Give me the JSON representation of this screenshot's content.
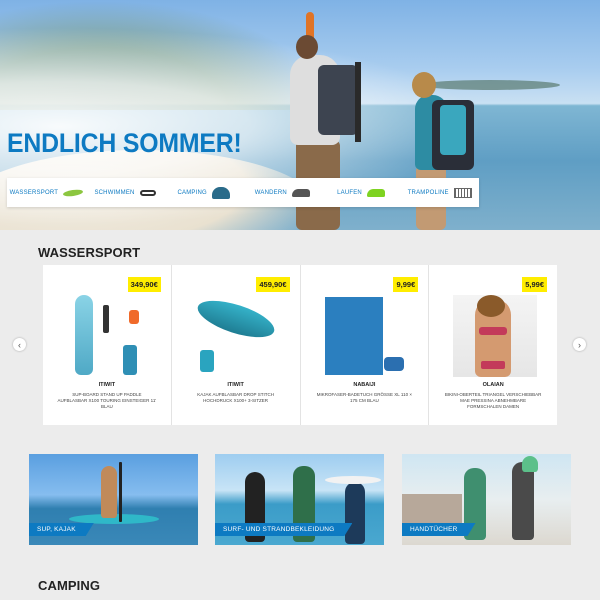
{
  "hero": {
    "title": "ENDLICH SOMMER!"
  },
  "categories": [
    {
      "label": "WASSERSPORT",
      "icon": "paddle-board-icon"
    },
    {
      "label": "SCHWIMMEN",
      "icon": "swim-goggles-icon"
    },
    {
      "label": "CAMPING",
      "icon": "tent-icon"
    },
    {
      "label": "WANDERN",
      "icon": "hiking-shoe-icon"
    },
    {
      "label": "LAUFEN",
      "icon": "running-shoe-icon"
    },
    {
      "label": "TRAMPOLINE",
      "icon": "trampoline-icon"
    }
  ],
  "sections": {
    "wassersport": "WASSERSPORT",
    "camping": "CAMPING"
  },
  "products": [
    {
      "price": "349,90€",
      "brand": "ITIWIT",
      "desc": "SUP-BOARD STAND UP PADDLE AUFBLASBAR X100 TOURING EINSTEIGER 11' BLAU"
    },
    {
      "price": "459,90€",
      "brand": "ITIWIT",
      "desc": "KAJAK AUFBLASBAR DROP STITCH HOCHDRUCK X100+ 3-SITZER"
    },
    {
      "price": "9,99€",
      "brand": "NABAIJI",
      "desc": "MIKROFASER-BADETUCH GRÖSSE XL 110 × 175 CM BLAU"
    },
    {
      "price": "5,99€",
      "brand": "OLAIAN",
      "desc": "BIKINI-OBERTEIL TRIANGEL VERSCHIEBBAR MAE PRESSINA ABNEHMBARE FORMSCHALEN DAMEN"
    }
  ],
  "promos": [
    {
      "label": "SUP, KAJAK"
    },
    {
      "label": "SURF- UND STRANDBEKLEIDUNG"
    },
    {
      "label": "HANDTÜCHER"
    }
  ],
  "colors": {
    "brand_blue": "#0d7ac2",
    "price_yellow": "#ffed00",
    "page_bg": "#ececec"
  }
}
